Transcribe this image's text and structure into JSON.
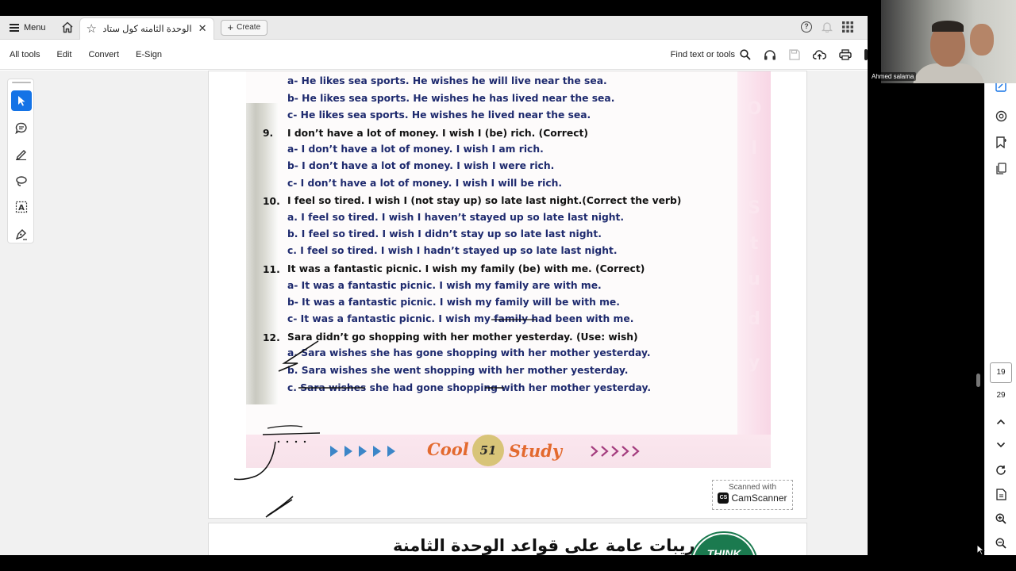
{
  "tabbar": {
    "menu_label": "Menu",
    "tab_title": "الوحدة الثامنه كول ستادي.pdf",
    "create_label": "Create"
  },
  "toolbar": {
    "all_tools": "All tools",
    "edit": "Edit",
    "convert": "Convert",
    "esign": "E-Sign",
    "find_placeholder": "Find text or tools"
  },
  "document": {
    "lines": [
      {
        "text": "a- He likes sea sports. He wishes he will live near the sea.",
        "kind": "opt"
      },
      {
        "text": "b- He likes sea sports. He wishes he has lived near the sea.",
        "kind": "opt"
      },
      {
        "text": "c- He likes sea sports. He wishes he lived near the sea.",
        "kind": "opt"
      },
      {
        "text": "I don’t have a lot of money. I wish I (be) rich. (Correct)",
        "kind": "q",
        "num": "9."
      },
      {
        "text": "a- I don’t have a lot of money. I wish I am rich.",
        "kind": "opt"
      },
      {
        "text": "b- I don’t have a lot of money. I wish I were rich.",
        "kind": "opt"
      },
      {
        "text": "c- I don’t have a lot of money. I wish I will be rich.",
        "kind": "opt"
      },
      {
        "text": "I feel so tired. I wish I (not stay up) so late last night.(Correct the verb)",
        "kind": "q",
        "num": "10."
      },
      {
        "text": "a. I feel so tired. I wish I haven’t stayed up so late last night.",
        "kind": "opt"
      },
      {
        "text": "b. I feel so tired. I wish I didn’t stay up so late last night.",
        "kind": "opt"
      },
      {
        "text": "c. I feel so tired. I wish I hadn’t stayed up so late last night.",
        "kind": "opt"
      },
      {
        "text": "It was a fantastic picnic. I wish my family (be) with me.  (Correct)",
        "kind": "q",
        "num": "11."
      },
      {
        "text": "a- It was a fantastic picnic. I wish my family are with me.",
        "kind": "opt"
      },
      {
        "text": "b- It was a fantastic picnic. I wish my family will be with me.",
        "kind": "opt"
      },
      {
        "text": "c- It was a fantastic picnic. I wish my family had been with me.",
        "kind": "opt"
      },
      {
        "text": "Sara didn’t go shopping with her mother yesterday. (Use: wish)",
        "kind": "q",
        "num": "12."
      },
      {
        "text": "a. Sara wishes she has gone shopping with her mother yesterday.",
        "kind": "opt"
      },
      {
        "text": "b. Sara wishes she went shopping with her mother yesterday.",
        "kind": "opt"
      },
      {
        "text": "c. Sara wishes she had gone shopping with her mother yesterday.",
        "kind": "opt"
      }
    ],
    "footer_left": "Cool",
    "footer_page": "51",
    "footer_right": "Study",
    "scanner_top": "Scanned with",
    "scanner_brand": "CamScanner",
    "scanner_logo": "CS",
    "next_page_heading": "تدريبات عامة على قواعد الوحدة الثامنة",
    "next_page_badge": "THINK"
  },
  "navigation": {
    "current_page": "19",
    "total_pages": "29"
  },
  "webcam": {
    "name_label": "Ahmed salama"
  },
  "colors": {
    "accent": "#1473e6",
    "option_text": "#1e2a6e",
    "footer_orange": "#e36a2f"
  }
}
